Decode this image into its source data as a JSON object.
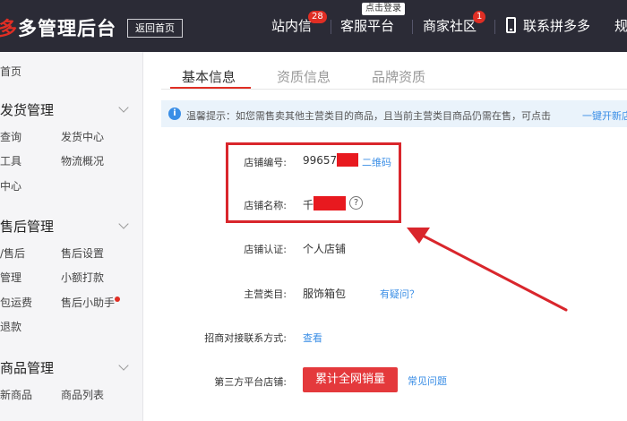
{
  "header": {
    "brand_prefix": "多",
    "brand_title": "多管理后台",
    "home_button": "返回首页",
    "login_hint": "点击登录",
    "nav": [
      {
        "label": "站内信",
        "badge": "28"
      },
      {
        "label": "客服平台"
      },
      {
        "label": "商家社区",
        "badge": "1"
      },
      {
        "label": "联系拼多多"
      },
      {
        "label": "规"
      }
    ]
  },
  "sidebar": {
    "home": "首页",
    "sections": [
      {
        "title": "发货管理",
        "items": [
          "查询",
          "发货中心",
          "工具",
          "物流概况",
          "中心"
        ]
      },
      {
        "title": "售后管理",
        "items": [
          "/售后",
          "售后设置",
          "管理",
          "小额打款",
          "包运费",
          "售后小助手",
          "退款"
        ]
      },
      {
        "title": "商品管理",
        "items": [
          "新商品",
          "商品列表"
        ]
      }
    ]
  },
  "tabs": [
    {
      "label": "基本信息",
      "active": true
    },
    {
      "label": "资质信息",
      "active": false
    },
    {
      "label": "品牌资质",
      "active": false
    }
  ],
  "notice": {
    "text": "温馨提示：如您需售卖其他主营类目的商品，且当前主营类目商品仍需在售，可点击",
    "link": "一键开新店"
  },
  "fields": {
    "shop_id_label": "店铺编号:",
    "shop_id_value": "99657",
    "qr_link": "二维码",
    "shop_name_label": "店铺名称:",
    "shop_name_value": "千",
    "auth_label": "店铺认证:",
    "auth_value": "个人店铺",
    "category_label": "主营类目:",
    "category_value": "服饰箱包",
    "category_link": "有疑问？",
    "contact_label": "招商对接联系方式:",
    "contact_link": "查看",
    "third_party_label": "第三方平台店铺:",
    "third_party_button": "累计全网销量",
    "faq_link": "常见问题"
  },
  "colors": {
    "topbar": "#2b2b36",
    "brand_red": "#e02e24",
    "link_blue": "#3a8ee6",
    "annotation_red": "#d9262c"
  }
}
